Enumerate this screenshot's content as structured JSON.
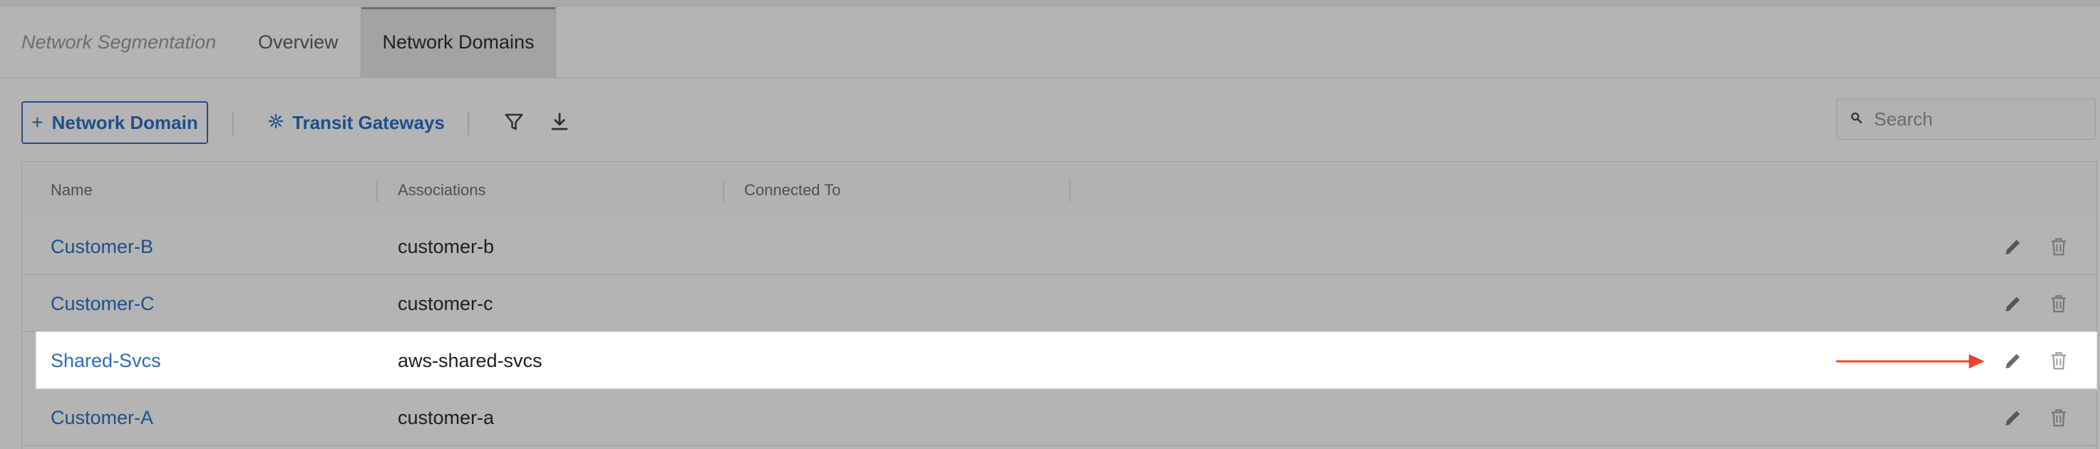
{
  "tabs": {
    "breadcrumb": "Network Segmentation",
    "overview": "Overview",
    "active": "Network Domains"
  },
  "toolbar": {
    "add_button": "Network Domain",
    "add_icon": "+",
    "transit_button": "Transit Gateways",
    "filter_icon": "filter-icon",
    "download_icon": "download-icon",
    "search_placeholder": "Search",
    "search_value": ""
  },
  "table": {
    "columns": [
      "Name",
      "Associations",
      "Connected To"
    ],
    "rows": [
      {
        "name": "Customer-B",
        "association": "customer-b",
        "connected_to": ""
      },
      {
        "name": "Customer-C",
        "association": "customer-c",
        "connected_to": ""
      },
      {
        "name": "Shared-Svcs",
        "association": "aws-shared-svcs",
        "connected_to": "",
        "highlighted": true
      },
      {
        "name": "Customer-A",
        "association": "customer-a",
        "connected_to": ""
      }
    ]
  },
  "annotation": {
    "arrow_color": "#e8442e",
    "points_to": "edit-icon"
  },
  "colors": {
    "accent": "#1d4f8c",
    "overlay": "#b4b4b4",
    "highlight_bg": "#ffffff"
  }
}
